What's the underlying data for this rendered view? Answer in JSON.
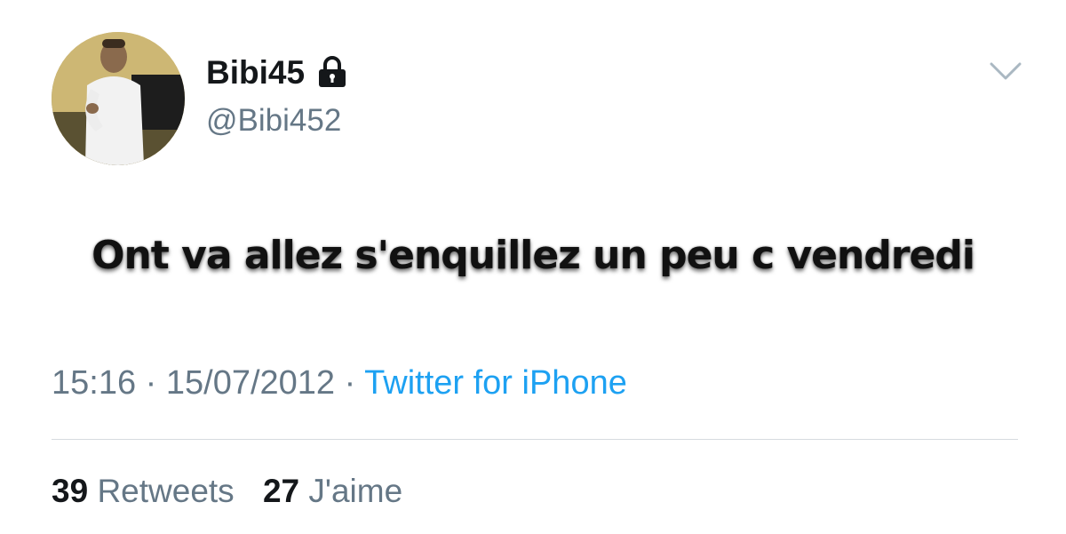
{
  "user": {
    "display_name": "Bibi45",
    "handle": "@Bibi452",
    "protected_icon": "lock-icon",
    "avatar_icon": "avatar"
  },
  "menu": {
    "icon": "chevron-down-icon"
  },
  "tweet": {
    "text": "Ont va allez s'enquillez un peu c vendredi"
  },
  "meta": {
    "time": "15:16",
    "separator1": " · ",
    "date": "15/07/2012",
    "separator2": " · ",
    "source": "Twitter for iPhone"
  },
  "stats": {
    "retweets_count": "39",
    "retweets_label": "Retweets",
    "likes_count": "27",
    "likes_label": "J'aime"
  },
  "colors": {
    "text": "#14171a",
    "secondary": "#657786",
    "link": "#1da1f2",
    "divider": "#d6dbe0"
  }
}
